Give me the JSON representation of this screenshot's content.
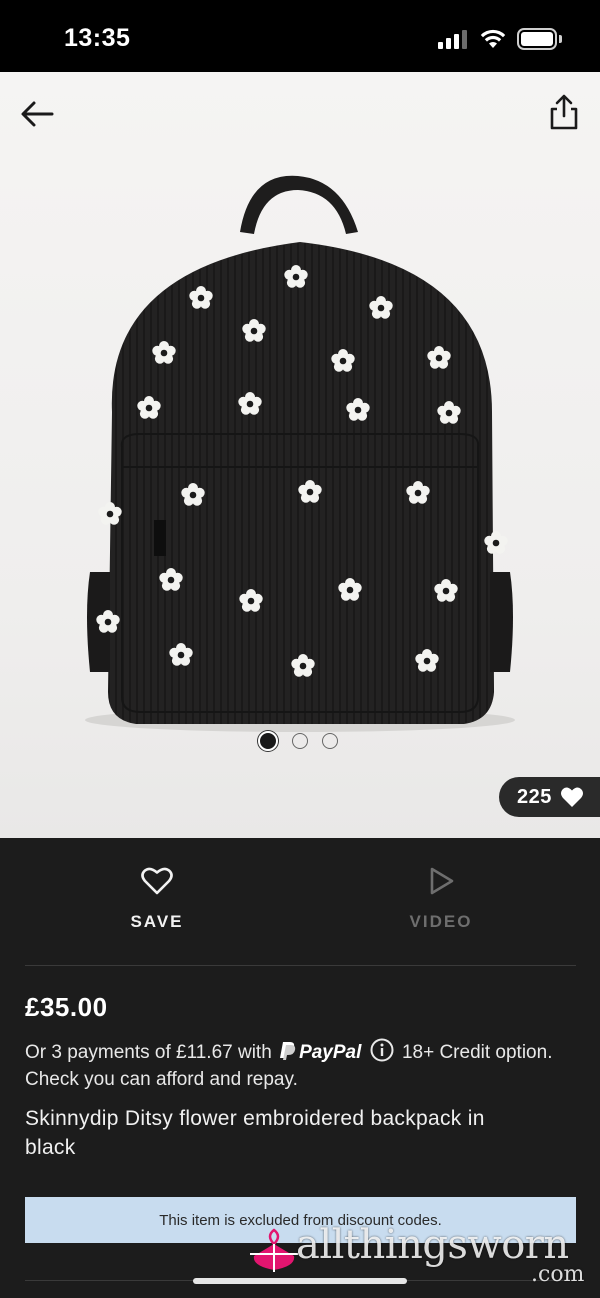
{
  "status_bar": {
    "time": "13:35"
  },
  "product_gallery": {
    "image_alt": "black corduroy backpack with white embroidered daisies",
    "dot_count": 3,
    "active_dot": 1,
    "likes": "225"
  },
  "actions": {
    "save_label": "SAVE",
    "video_label": "VIDEO"
  },
  "product": {
    "price": "£35.00",
    "installment_prefix": "Or 3 payments of £11.67 with",
    "paypal_label": "PayPal",
    "installment_suffix": "18+ Credit option. Check you can afford and repay.",
    "title": "Skinnydip Ditsy flower embroidered backpack in black"
  },
  "notice": {
    "text": "This item is excluded from discount codes."
  },
  "watermark": {
    "text": "allthingsworn",
    "sub": ".com"
  },
  "icons": {
    "back": "arrow-left-icon",
    "share": "share-icon",
    "save": "heart-outline-icon",
    "video": "play-icon",
    "likes": "heart-filled-icon",
    "info": "info-icon",
    "paypal": "paypal-logo-icon"
  },
  "colors": {
    "dark_panel": "#1c1c1c",
    "notice_bg": "#c8dcef",
    "watermark_accent": "#e2156f"
  }
}
